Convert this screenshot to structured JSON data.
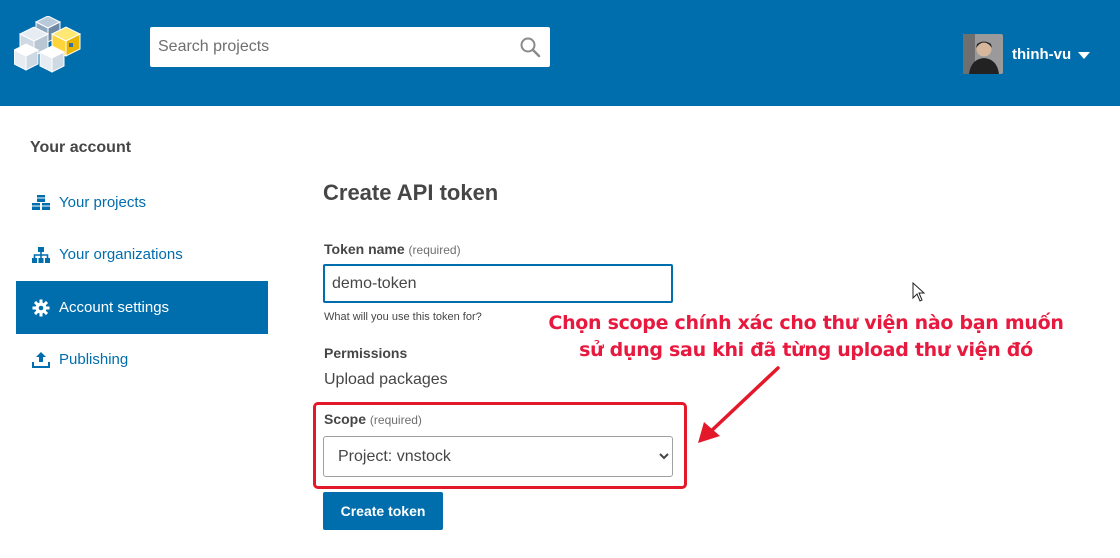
{
  "header": {
    "search": {
      "placeholder": "Search projects"
    },
    "user": {
      "name": "thinh-vu"
    }
  },
  "sidebar": {
    "title": "Your account",
    "items": [
      {
        "label": "Your projects",
        "icon": "cubes-icon",
        "active": false
      },
      {
        "label": "Your organizations",
        "icon": "sitemap-icon",
        "active": false
      },
      {
        "label": "Account settings",
        "icon": "gear-icon",
        "active": true
      },
      {
        "label": "Publishing",
        "icon": "upload-icon",
        "active": false
      }
    ]
  },
  "main": {
    "title": "Create API token",
    "token_name": {
      "label": "Token name",
      "required": "(required)",
      "value": "demo-token",
      "help": "What will you use this token for?"
    },
    "permissions": {
      "label": "Permissions",
      "value": "Upload packages"
    },
    "scope": {
      "label": "Scope",
      "required": "(required)",
      "selected": "Project: vnstock"
    },
    "create_button": "Create token"
  },
  "annotation": {
    "line1": "Chọn scope chính xác cho thư viện nào bạn muốn",
    "line2": "sử dụng sau khi đã từng upload thư viện đó",
    "color": "#e8193f"
  },
  "colors": {
    "brand": "#006dad",
    "highlight_border": "#e3192a"
  }
}
